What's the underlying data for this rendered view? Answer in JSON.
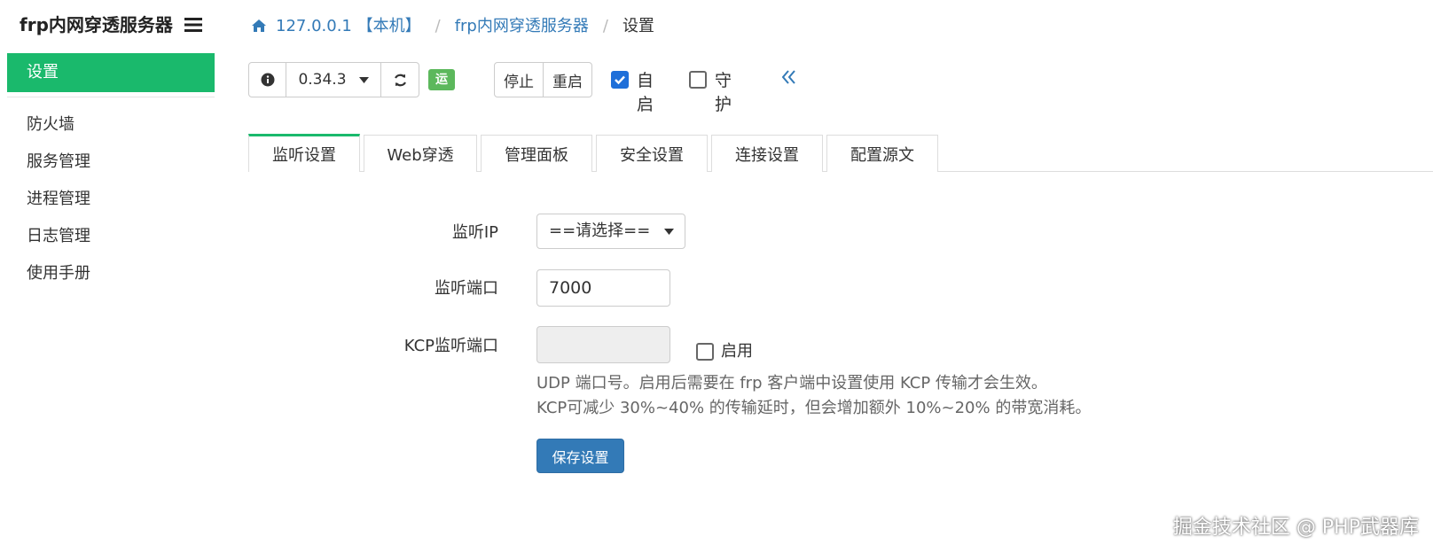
{
  "app": {
    "brand": "frp内网穿透服务器",
    "menu_icon": "hamburger-icon"
  },
  "sidebar": {
    "items": [
      {
        "label": "设置",
        "active": true
      },
      {
        "label": "防火墙",
        "active": false
      },
      {
        "label": "服务管理",
        "active": false
      },
      {
        "label": "进程管理",
        "active": false
      },
      {
        "label": "日志管理",
        "active": false
      },
      {
        "label": "使用手册",
        "active": false
      }
    ],
    "active_color": "#1ab96c"
  },
  "breadcrumb": {
    "home_icon": "home-icon",
    "host": "127.0.0.1 【本机】",
    "app": "frp内网穿透服务器",
    "current": "设置",
    "separator": "/"
  },
  "toolbar": {
    "info_icon": "info-icon",
    "version": "0.34.3",
    "refresh_icon": "refresh-icon",
    "status": "运行中",
    "status_color": "#5cb85c",
    "stop_label": "停止",
    "restart_label": "重启",
    "autostart_label": "自启",
    "autostart_checked": true,
    "guard_label": "守护",
    "guard_checked": false,
    "collapse_icon": "double-chevron-left-icon"
  },
  "tabs": [
    {
      "label": "监听设置",
      "active": true
    },
    {
      "label": "Web穿透",
      "active": false
    },
    {
      "label": "管理面板",
      "active": false
    },
    {
      "label": "安全设置",
      "active": false
    },
    {
      "label": "连接设置",
      "active": false
    },
    {
      "label": "配置源文",
      "active": false
    }
  ],
  "form": {
    "listen_ip_label": "监听IP",
    "listen_ip_value": "==请选择==",
    "listen_port_label": "监听端口",
    "listen_port_value": "7000",
    "kcp_port_label": "KCP监听端口",
    "kcp_port_value": "",
    "kcp_enable_label": "启用",
    "kcp_enable_checked": false,
    "help_line1": "UDP 端口号。启用后需要在 frp 客户端中设置使用 KCP 传输才会生效。",
    "help_line2": "KCP可减少 30%~40% 的传输延时，但会增加额外 10%~20% 的带宽消耗。",
    "save_label": "保存设置",
    "save_color": "#337ab7"
  },
  "watermark": "掘金技术社区 @ PHP武器库"
}
